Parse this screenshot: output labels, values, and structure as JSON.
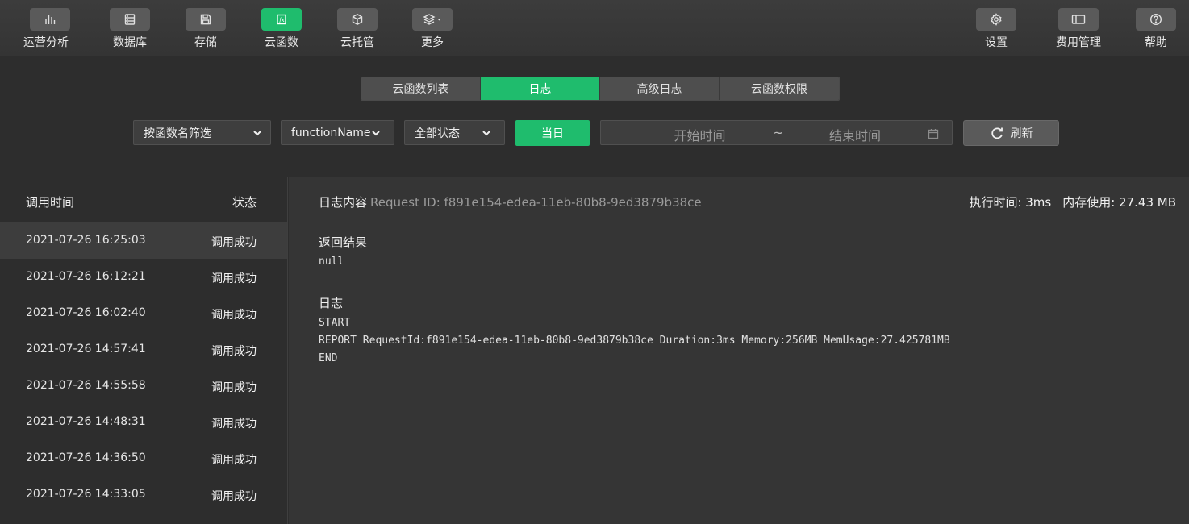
{
  "toolbar": {
    "left": [
      {
        "label": "运营分析",
        "icon": "bar-chart-icon"
      },
      {
        "label": "数据库",
        "icon": "database-icon"
      },
      {
        "label": "存储",
        "icon": "save-icon"
      },
      {
        "label": "云函数",
        "icon": "function-icon",
        "active": true
      },
      {
        "label": "云托管",
        "icon": "cube-icon"
      },
      {
        "label": "更多",
        "icon": "layers-icon"
      }
    ],
    "right": [
      {
        "label": "设置",
        "icon": "gear-icon"
      },
      {
        "label": "费用管理",
        "icon": "ticket-icon"
      },
      {
        "label": "帮助",
        "icon": "help-icon"
      }
    ]
  },
  "tabs": [
    "云函数列表",
    "日志",
    "高级日志",
    "云函数权限"
  ],
  "filters": {
    "function_filter": "按函数名筛选",
    "function_name": "functionName",
    "status": "全部状态",
    "today": "当日",
    "start_placeholder": "开始时间",
    "separator": "~",
    "end_placeholder": "结束时间",
    "refresh": "刷新"
  },
  "list": {
    "header_time": "调用时间",
    "header_status": "状态",
    "rows": [
      {
        "time": "2021-07-26 16:25:03",
        "status": "调用成功"
      },
      {
        "time": "2021-07-26 16:12:21",
        "status": "调用成功"
      },
      {
        "time": "2021-07-26 16:02:40",
        "status": "调用成功"
      },
      {
        "time": "2021-07-26 14:57:41",
        "status": "调用成功"
      },
      {
        "time": "2021-07-26 14:55:58",
        "status": "调用成功"
      },
      {
        "time": "2021-07-26 14:48:31",
        "status": "调用成功"
      },
      {
        "time": "2021-07-26 14:36:50",
        "status": "调用成功"
      },
      {
        "time": "2021-07-26 14:33:05",
        "status": "调用成功"
      }
    ]
  },
  "detail": {
    "title": "日志内容",
    "request_id": "Request ID: f891e154-edea-11eb-80b8-9ed3879b38ce",
    "exec_time": "执行时间: 3ms",
    "memory": "内存使用: 27.43 MB",
    "result_title": "返回结果",
    "result": "null",
    "log_title": "日志",
    "log_lines": [
      "START",
      "REPORT RequestId:f891e154-edea-11eb-80b8-9ed3879b38ce Duration:3ms Memory:256MB MemUsage:27.425781MB",
      "END"
    ]
  },
  "colors": {
    "accent": "#1fbc6d",
    "background": "#2d2d2d",
    "panel": "#353535"
  }
}
